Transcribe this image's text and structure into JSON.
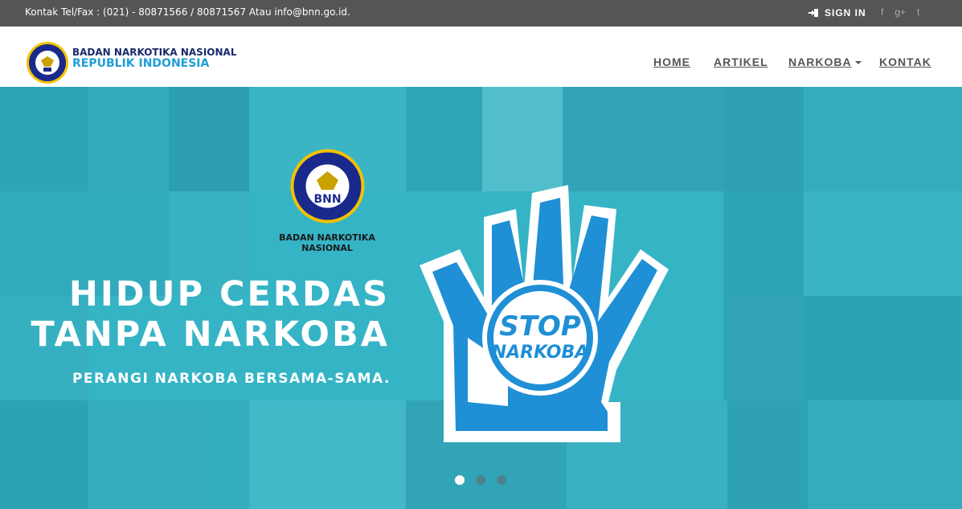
{
  "topbar": {
    "contact": "Kontak Tel/Fax : (021) - 80871566 / 80871567 Atau info@bnn.go.id.",
    "signin": "SIGN IN",
    "socials": [
      "f",
      "g+",
      "t"
    ]
  },
  "nav": {
    "brand_line1": "BADAN NARKOTIKA NASIONAL",
    "brand_line2": "REPUBLIK INDONESIA",
    "items": [
      "HOME",
      "ARTIKEL",
      "NARKOBA",
      "KONTAK"
    ]
  },
  "hero": {
    "logo_caption": "BADAN NARKOTIKA NASIONAL",
    "logo_text": "BNN",
    "headline1": "HIDUP CERDAS",
    "headline2": "TANPA NARKOBA",
    "subheadline": "PERANGI NARKOBA BERSAMA-SAMA.",
    "stop_text1": "STOP",
    "stop_text2": "NARKOBA",
    "slides": 3,
    "active_slide": 0
  },
  "colors": {
    "topbar": "#555555",
    "brand_blue": "#1e9ed6",
    "brand_navy": "#1a2a6c",
    "hero": "#3cb0c2"
  }
}
